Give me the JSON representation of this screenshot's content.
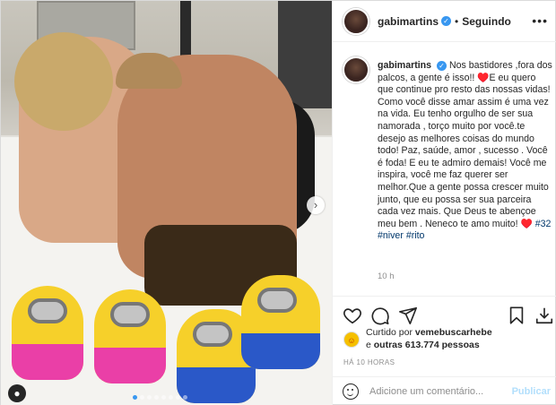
{
  "post": {
    "username": "gabimartins",
    "follow_status": "Seguindo",
    "caption_username": "gabimartins",
    "caption_part1": "Nos bastidores ,fora dos palcos, a gente é isso!! ",
    "caption_part2": "♥️",
    "caption_part3": "E eu quero que continue pro resto das nossas vidas! Como você disse amar assim é uma vez na vida. Eu tenho orgulho de ser sua namorada , torço muito por você.te desejo as melhores coisas do mundo todo! Paz, saúde, amor , sucesso . Você é foda! E eu te admiro demais! Você me inspira, você me faz querer ser melhor.Que a gente possa crescer muito junto, que eu possa ser sua parceira cada vez mais. Que Deus te abençoe meu bem . Neneco te amo muito! ",
    "caption_heart": "♥️",
    "hashtags": [
      "#32",
      "#niver",
      "#rito"
    ],
    "caption_time": "10 h",
    "likes_prefix": "Curtido por ",
    "likes_user": "vemebuscarhebe",
    "likes_mid": "e ",
    "likes_others": "outras 613.774 pessoas",
    "post_time": "HÁ 10 HORAS",
    "comment_placeholder": "Adicione um comentário...",
    "publish_label": "Publicar"
  },
  "carousel": {
    "total": 8,
    "active_index": 0
  },
  "icons": {
    "verified": "verified-badge-icon",
    "more": "more-options-icon",
    "heart": "heart-icon",
    "comment": "comment-icon",
    "share": "share-icon",
    "save": "bookmark-icon",
    "download": "download-icon",
    "emoji": "emoji-icon",
    "next": "chevron-right-icon",
    "user_tag": "user-tag-icon"
  },
  "colors": {
    "accent": "#3897f0",
    "heart": "#e0245e",
    "hashtag": "#00376b",
    "publish_disabled": "#b2dffc"
  }
}
